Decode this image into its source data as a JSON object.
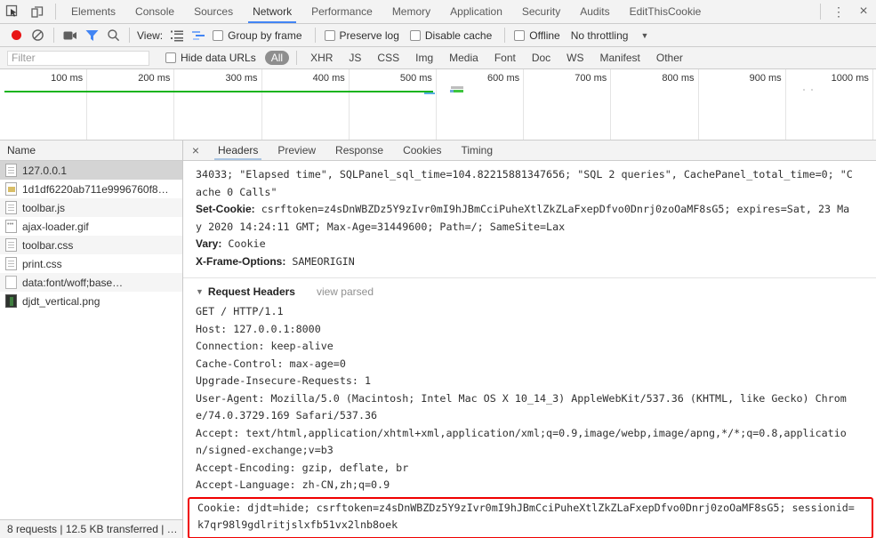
{
  "colors": {
    "accent_blue": "#4285f4",
    "record_red": "#e81515",
    "overview_green": "#17b41e",
    "highlight_red": "#f00000",
    "selection_gray": "#d4d4d4"
  },
  "tabs": {
    "main": [
      "Elements",
      "Console",
      "Sources",
      "Network",
      "Performance",
      "Memory",
      "Application",
      "Security",
      "Audits",
      "EditThisCookie"
    ],
    "active_main": "Network"
  },
  "toolbar": {
    "view_label": "View:",
    "group_by_frame": "Group by frame",
    "preserve_log": "Preserve log",
    "disable_cache": "Disable cache",
    "offline": "Offline",
    "throttling": "No throttling"
  },
  "filter": {
    "placeholder": "Filter",
    "hide_data_urls": "Hide data URLs",
    "types": [
      "All",
      "XHR",
      "JS",
      "CSS",
      "Img",
      "Media",
      "Font",
      "Doc",
      "WS",
      "Manifest",
      "Other"
    ],
    "active_type": "All"
  },
  "timeline": {
    "ticks": [
      "100 ms",
      "200 ms",
      "300 ms",
      "400 ms",
      "500 ms",
      "600 ms",
      "700 ms",
      "800 ms",
      "900 ms",
      "1000 ms"
    ]
  },
  "sidebar": {
    "header": "Name",
    "files": [
      {
        "name": "127.0.0.1"
      },
      {
        "name": "1d1df6220ab711e9996760f8…"
      },
      {
        "name": "toolbar.js"
      },
      {
        "name": "ajax-loader.gif"
      },
      {
        "name": "toolbar.css"
      },
      {
        "name": "print.css"
      },
      {
        "name": "data:font/woff;base…"
      },
      {
        "name": "djdt_vertical.png"
      }
    ],
    "status": "8 requests | 12.5 KB transferred | …"
  },
  "detail": {
    "tabs": [
      "Headers",
      "Preview",
      "Response",
      "Cookies",
      "Timing"
    ],
    "active_tab": "Headers",
    "response_lines": [
      {
        "name": "",
        "text": "34033; \"Elapsed time\", SQLPanel_sql_time=104.82215881347656; \"SQL 2 queries\", CachePanel_total_time=0; \"C"
      },
      {
        "name": "",
        "text": "ache 0 Calls\""
      },
      {
        "name": "Set-Cookie:",
        "text": " csrftoken=z4sDnWBZDz5Y9zIvr0mI9hJBmCciPuheXtlZkZLaFxepDfvo0Dnrj0zoOaMF8sG5; expires=Sat, 23 Ma"
      },
      {
        "name": "",
        "text": "y 2020 14:24:11 GMT; Max-Age=31449600; Path=/; SameSite=Lax"
      },
      {
        "name": "Vary:",
        "text": " Cookie"
      },
      {
        "name": "X-Frame-Options:",
        "text": " SAMEORIGIN"
      }
    ],
    "request_headers": {
      "title": "Request Headers",
      "view_parsed": "view parsed",
      "raw": [
        "GET / HTTP/1.1",
        "Host: 127.0.0.1:8000",
        "Connection: keep-alive",
        "Cache-Control: max-age=0",
        "Upgrade-Insecure-Requests: 1",
        "User-Agent: Mozilla/5.0 (Macintosh; Intel Mac OS X 10_14_3) AppleWebKit/537.36 (KHTML, like Gecko) Chrom",
        "e/74.0.3729.169 Safari/537.36",
        "Accept: text/html,application/xhtml+xml,application/xml;q=0.9,image/webp,image/apng,*/*;q=0.8,applicatio",
        "n/signed-exchange;v=b3",
        "Accept-Encoding: gzip, deflate, br",
        "Accept-Language: zh-CN,zh;q=0.9"
      ],
      "cookie_highlight": [
        "Cookie: djdt=hide; csrftoken=z4sDnWBZDz5Y9zIvr0mI9hJBmCciPuheXtlZkZLaFxepDfvo0Dnrj0zoOaMF8sG5; sessionid=",
        "k7qr98l9gdlritjslxfb51vx2lnb8oek"
      ]
    }
  }
}
